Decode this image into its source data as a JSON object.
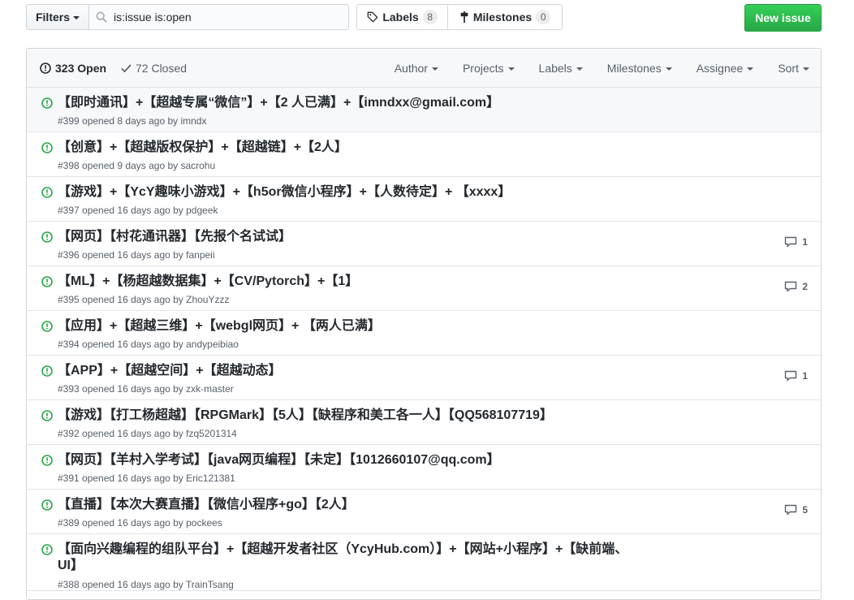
{
  "toolbar": {
    "filters_label": "Filters",
    "search_value": "is:issue is:open",
    "labels_label": "Labels",
    "labels_count": "8",
    "milestones_label": "Milestones",
    "milestones_count": "0",
    "new_issue_label": "New issue"
  },
  "header": {
    "open_label": "323 Open",
    "closed_label": "72 Closed",
    "menus": [
      "Author",
      "Projects",
      "Labels",
      "Milestones",
      "Assignee",
      "Sort"
    ]
  },
  "colors": {
    "open_green": "#28a745",
    "button_green": "#2cbe4e"
  },
  "issues": [
    {
      "title": "【即时通讯】+【超越专属“微信”】+【2 人已满】+【imndxx@gmail.com】",
      "meta": "#399 opened 8 days ago by imndx",
      "comments": ""
    },
    {
      "title": "【创意】+【超越版权保护】+【超越链】+【2人】",
      "meta": "#398 opened 9 days ago by sacrohu",
      "comments": ""
    },
    {
      "title": "【游戏】+【YcY趣味小游戏】+【h5or微信小程序】+【人数待定】+ 【xxxx】",
      "meta": "#397 opened 16 days ago by pdgeek",
      "comments": ""
    },
    {
      "title": "【网页】【村花通讯器】【先报个名试试】",
      "meta": "#396 opened 16 days ago by fanpeii",
      "comments": "1"
    },
    {
      "title": "【ML】+【杨超越数据集】+【CV/Pytorch】+【1】",
      "meta": "#395 opened 16 days ago by ZhouYzzz",
      "comments": "2"
    },
    {
      "title": "【应用】+【超越三维】+【webgl网页】+ 【两人已满】",
      "meta": "#394 opened 16 days ago by andypeibiao",
      "comments": ""
    },
    {
      "title": "【APP】+【超越空间】+【超越动态】",
      "meta": "#393 opened 16 days ago by zxk-master",
      "comments": "1"
    },
    {
      "title": "【游戏】【打工杨超越】【RPGMark】【5人】【缺程序和美工各一人】【QQ568107719】",
      "meta": "#392 opened 16 days ago by fzq5201314",
      "comments": ""
    },
    {
      "title": "【网页】【羊村入学考试】【java网页编程】【未定】【1012660107@qq.com】",
      "meta": "#391 opened 16 days ago by Eric121381",
      "comments": ""
    },
    {
      "title": "【直播】【本次大赛直播】【微信小程序+go】【2人】",
      "meta": "#389 opened 16 days ago by pockees",
      "comments": "5"
    },
    {
      "title": "【面向兴趣编程的组队平台】+【超越开发者社区（YcyHub.com）】+【网站+小程序】+【缺前端、UI】",
      "meta": "#388 opened 16 days ago by TrainTsang",
      "comments": ""
    }
  ]
}
